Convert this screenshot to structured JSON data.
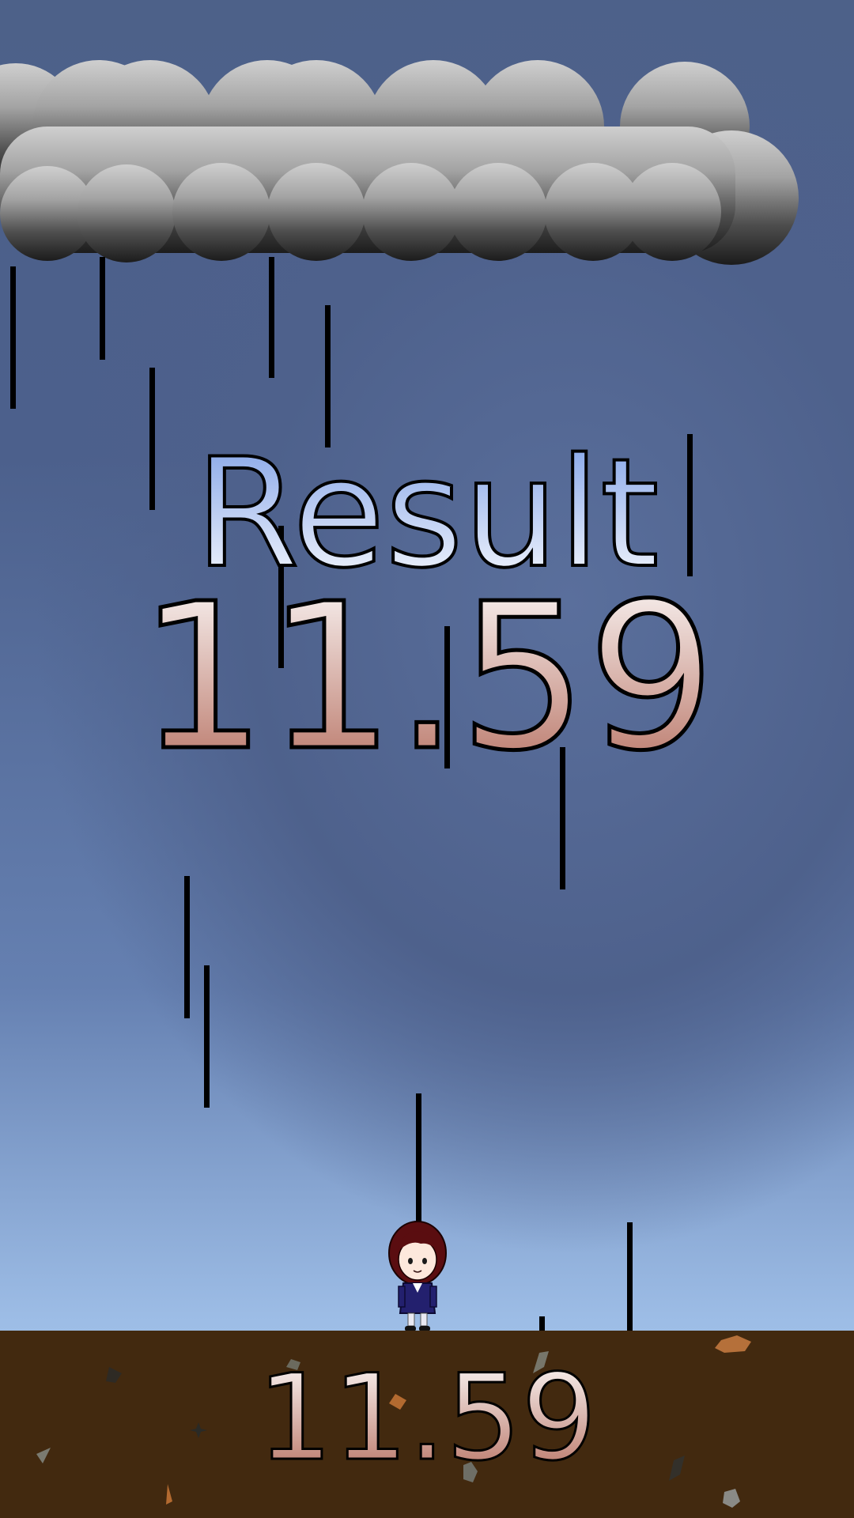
{
  "result": {
    "title": "Result",
    "value": "11.59"
  },
  "ground": {
    "score": "11.59"
  },
  "colors": {
    "sky_top": "#4d6189",
    "sky_bottom": "#a6c6ec",
    "ground": "#42290f",
    "cloud_top": "#c9c9c9",
    "cloud_bottom": "#1e1e1e",
    "title_gradient_top": "#7c9ee6",
    "title_gradient_bottom": "#ffffff",
    "score_gradient_top": "#ffffff",
    "score_gradient_bottom": "#b36a5a"
  },
  "icons": {
    "cloud": "storm-cloud-icon",
    "character": "schoolgirl-character-icon",
    "rain": "raindrop-line"
  }
}
